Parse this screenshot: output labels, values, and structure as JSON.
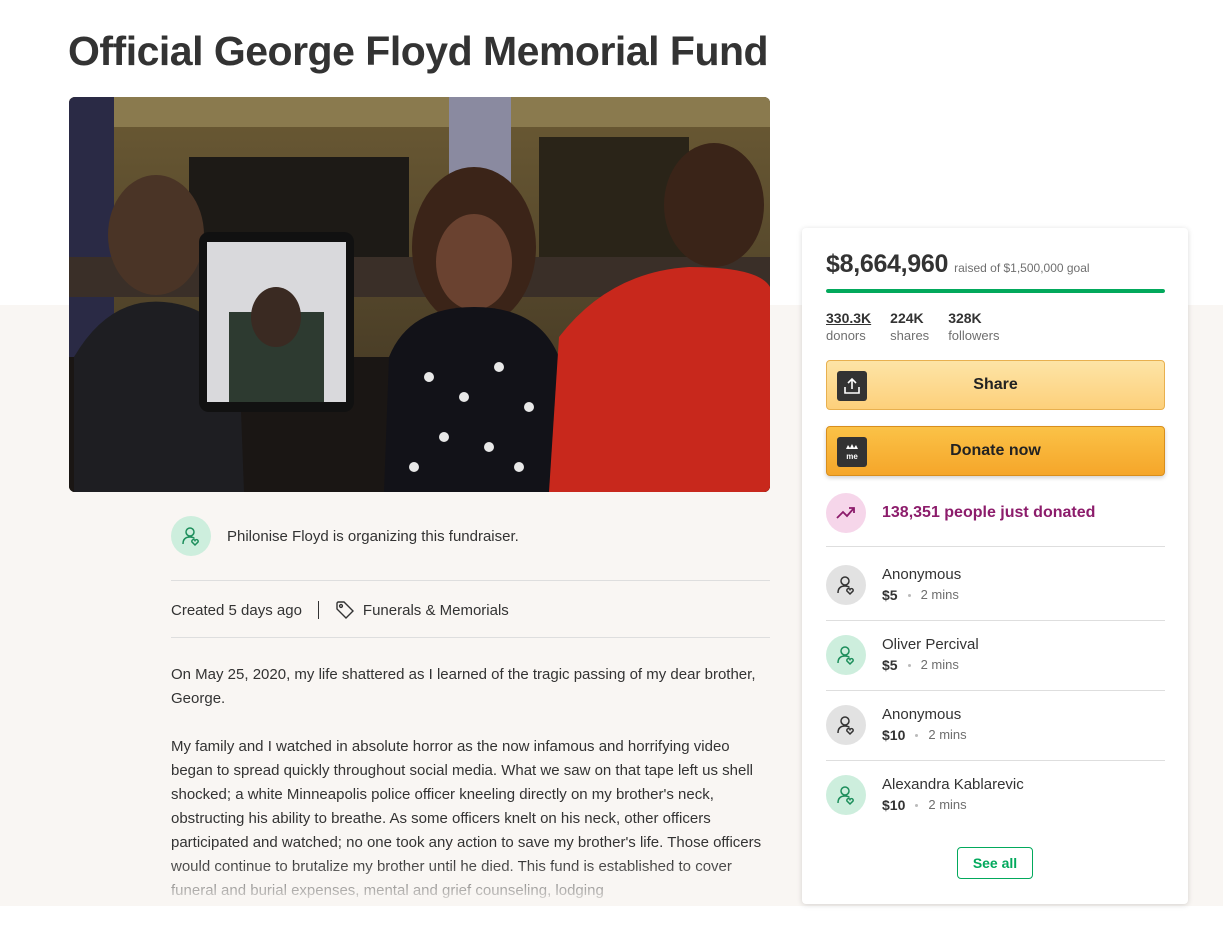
{
  "title": "Official George Floyd Memorial Fund",
  "organizer": {
    "text": "Philonise Floyd is organizing this fundraiser."
  },
  "meta": {
    "created": "Created 5 days ago",
    "category": "Funerals & Memorials"
  },
  "story": [
    "On May 25, 2020, my life shattered as I learned of the tragic passing of my dear brother, George.",
    "My family and I watched in absolute horror as the now infamous and horrifying video began to spread quickly throughout social media. What we saw on that tape left us shell shocked; a white Minneapolis police officer kneeling directly on my brother's neck, obstructing his ability to breathe. As some officers knelt on his neck, other officers participated and watched; no one took any action to save my brother's life.  Those officers would continue to brutalize my brother until he died. This fund is established to cover funeral and burial expenses, mental and grief counseling, lodging"
  ],
  "sidebar": {
    "raised_amount": "$8,664,960",
    "raised_goal": "raised of $1,500,000 goal",
    "progress_fraction": 1.0,
    "stats": [
      {
        "value": "330.3K",
        "label": "donors"
      },
      {
        "value": "224K",
        "label": "shares"
      },
      {
        "value": "328K",
        "label": "followers"
      }
    ],
    "share_label": "Share",
    "donate_label": "Donate now",
    "recent_donations_text": "138,351 people just donated",
    "donations": [
      {
        "name": "Anonymous",
        "amount": "$5",
        "time": "2 mins"
      },
      {
        "name": "Oliver Percival",
        "amount": "$5",
        "time": "2 mins"
      },
      {
        "name": "Anonymous",
        "amount": "$10",
        "time": "2 mins"
      },
      {
        "name": "Alexandra Kablarevic",
        "amount": "$10",
        "time": "2 mins"
      }
    ],
    "see_all_label": "See all"
  },
  "colors": {
    "brand_green": "#02a95c",
    "donate_orange": "#f5a62a",
    "trend_purple": "#8c1c6b",
    "page_band": "#f9f6f3"
  },
  "icons": [
    "organizer-icon",
    "tag-icon",
    "share-icon",
    "gofundme-icon",
    "trending-icon",
    "donor-icon"
  ]
}
